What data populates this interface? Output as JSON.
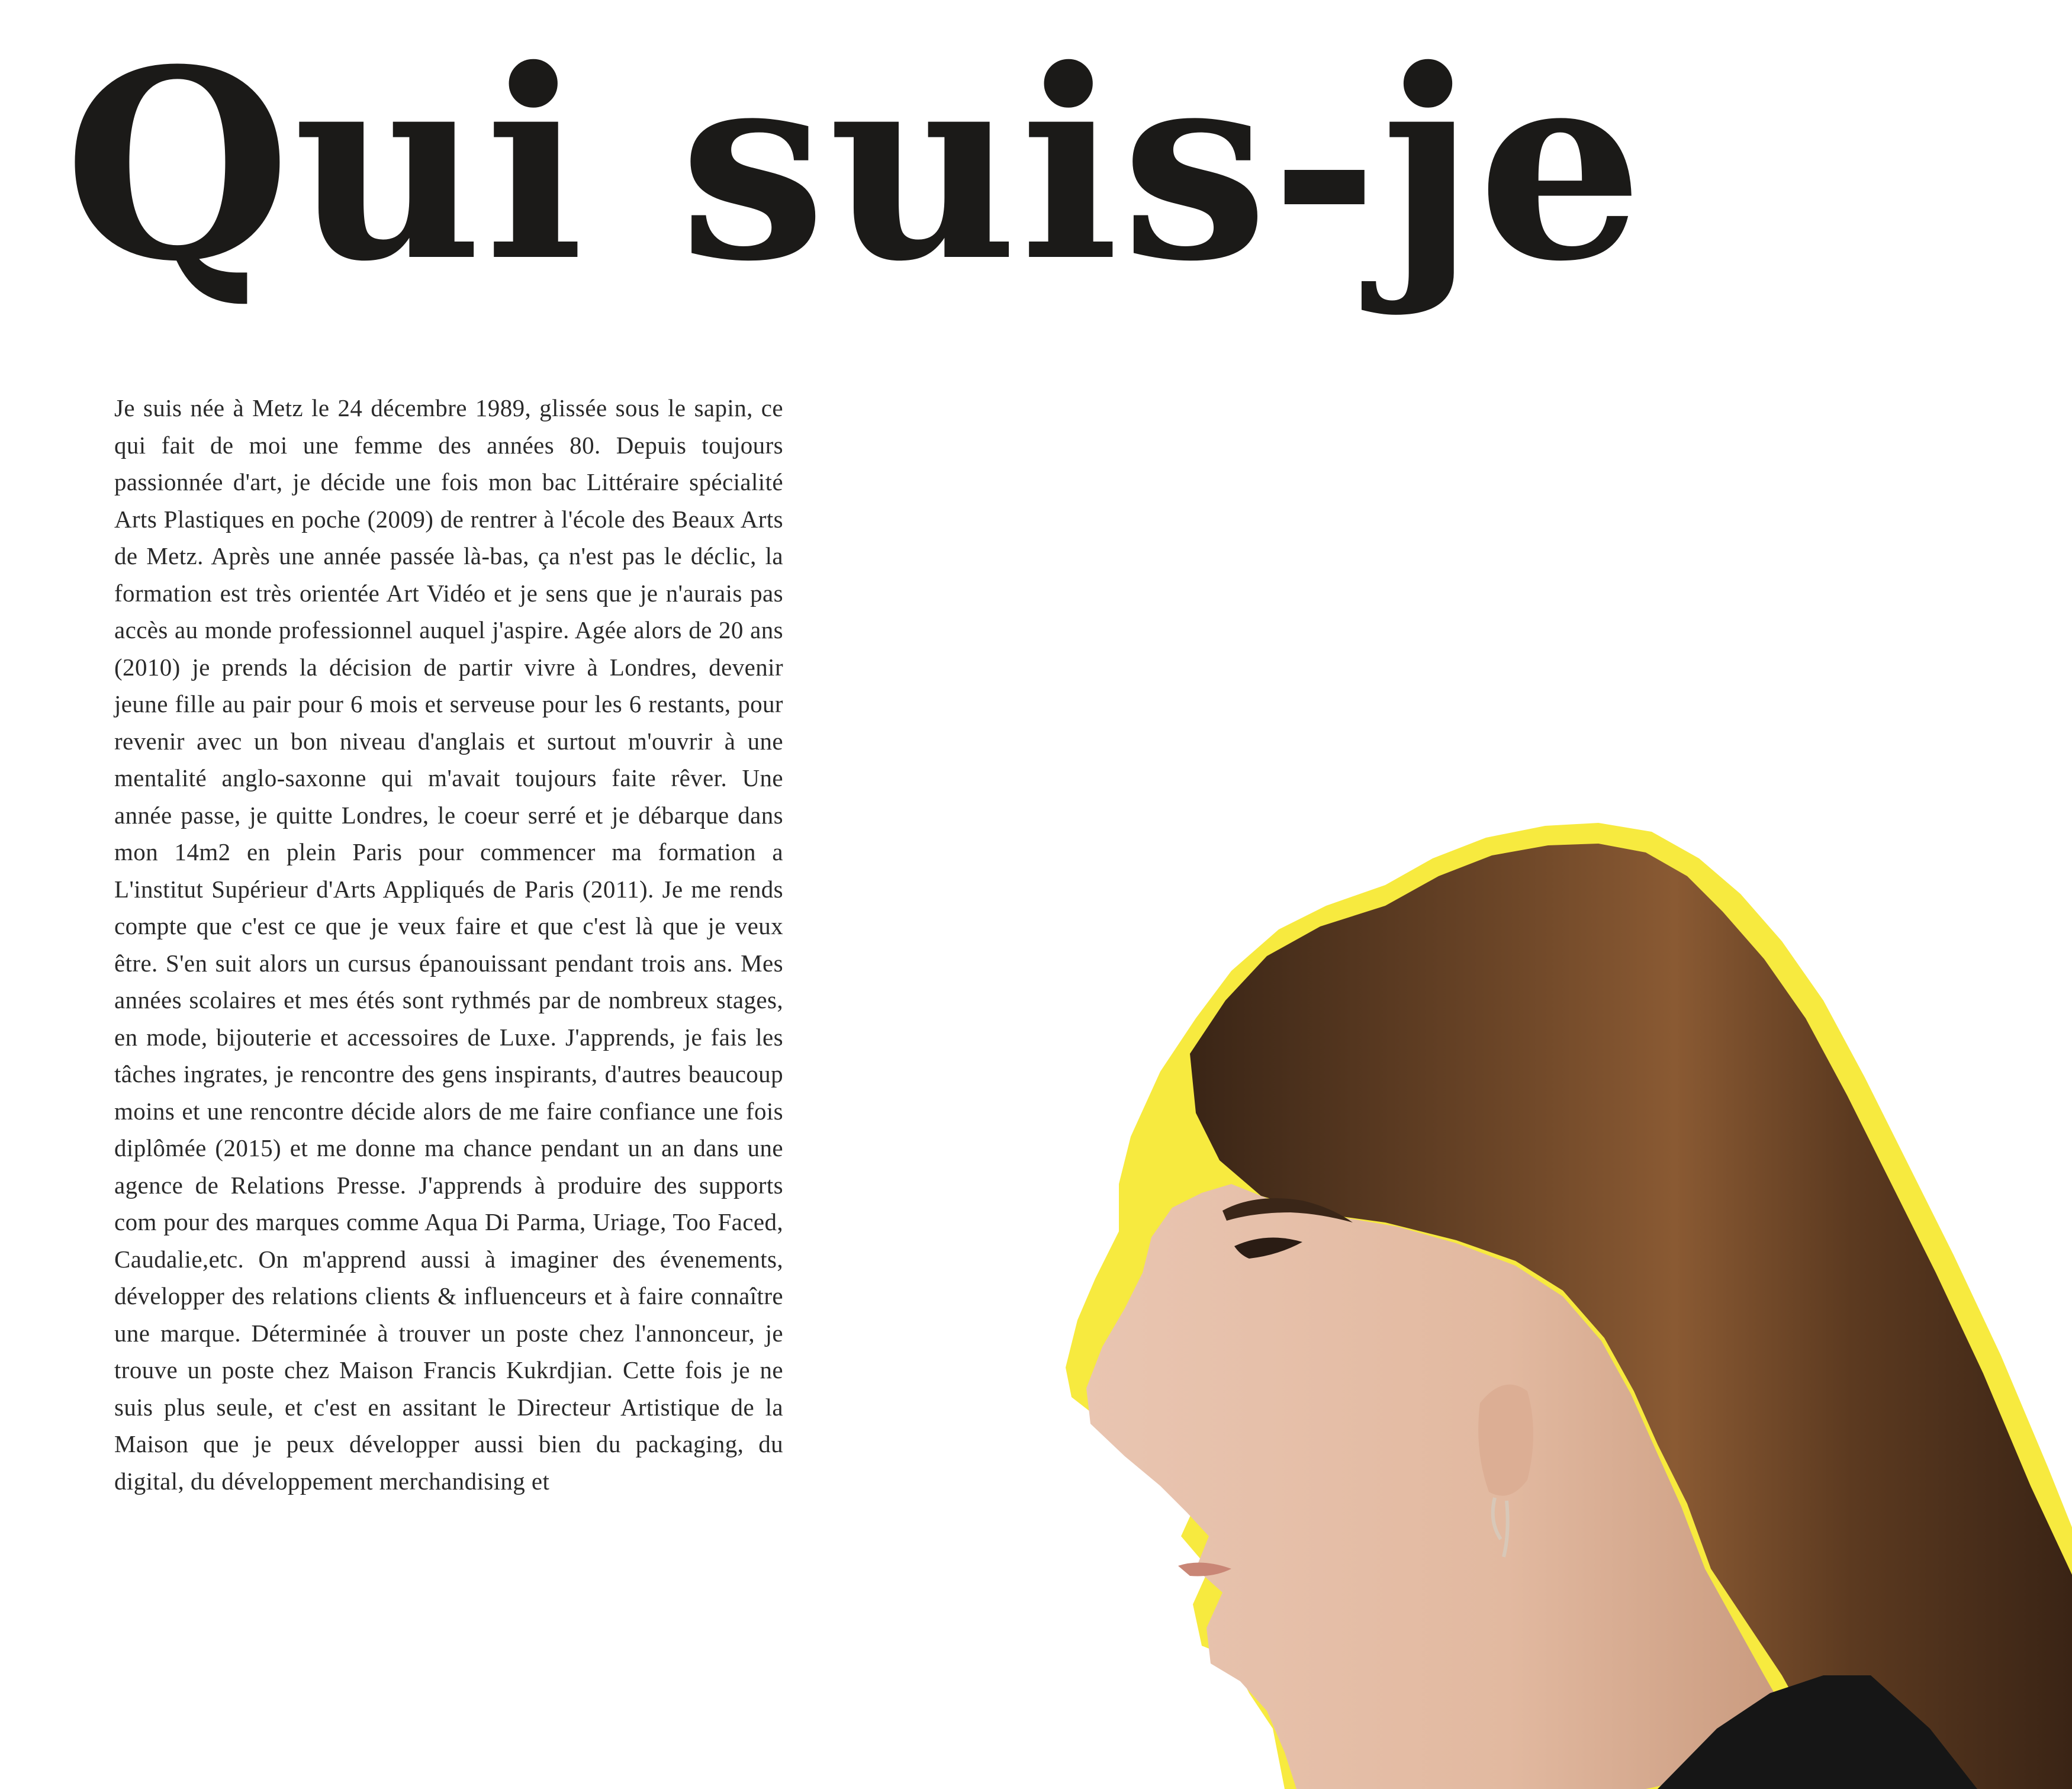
{
  "page": {
    "title": "Qui suis-je",
    "bio": "Je suis née à Metz le 24 décembre 1989, glissée sous le sapin, ce qui fait de moi une femme des années 80. Depuis toujours passionnée d'art, je décide une fois mon bac Littéraire spécialité Arts Plastiques en poche (2009) de rentrer à l'école des Beaux Arts de Metz. Après une année passée là-bas, ça n'est pas le déclic, la formation est très orientée Art Vidéo et je sens que je n'aurais pas accès au monde professionnel auquel j'aspire. Agée alors de 20 ans (2010) je prends la décision de partir vivre à Londres, devenir jeune fille au pair pour 6 mois et serveuse pour les 6 restants, pour revenir avec un bon niveau d'anglais et surtout m'ouvrir à une mentalité anglo-saxonne qui m'avait toujours faite rêver. Une année passe, je quitte Londres, le coeur serré et je débarque dans mon 14m2 en plein Paris pour commencer ma formation a L'institut Supérieur d'Arts Appliqués de Paris (2011). Je me rends compte que c'est ce que je veux faire et que c'est là que je veux être. S'en suit alors un cursus épanouissant pendant trois ans. Mes années scolaires et mes étés sont rythmés par de nombreux stages, en mode, bijouterie et accessoires de Luxe. J'apprends, je fais les tâches ingrates, je rencontre des gens inspirants, d'autres beaucoup moins et une rencontre décide alors de me faire confiance une fois diplômée (2015) et me donne ma chance pendant un an dans une agence de Relations Presse. J'apprends à produire des supports com pour des marques comme Aqua Di Parma, Uriage, Too Faced, Caudalie,etc. On m'apprend aussi à imaginer des évenements, développer des relations clients & influenceurs et à faire connaître une marque. Déterminée à trouver un poste chez l'annonceur, je trouve un poste chez Maison Francis Kukrdjian. Cette fois je ne suis plus seule, et c'est en assitant le Directeur Artistique de la Maison que je peux développer aussi bien du packaging, du digital, du développement merchandising et"
  },
  "colors": {
    "title": "#1b1a18",
    "text": "#2a2a2a",
    "outline": "#f7ea3f",
    "skin": "#e7c3ad",
    "hair": "#5a3a22",
    "sweater": "#161616"
  },
  "portrait": {
    "icon": "profile-portrait-cutout"
  }
}
